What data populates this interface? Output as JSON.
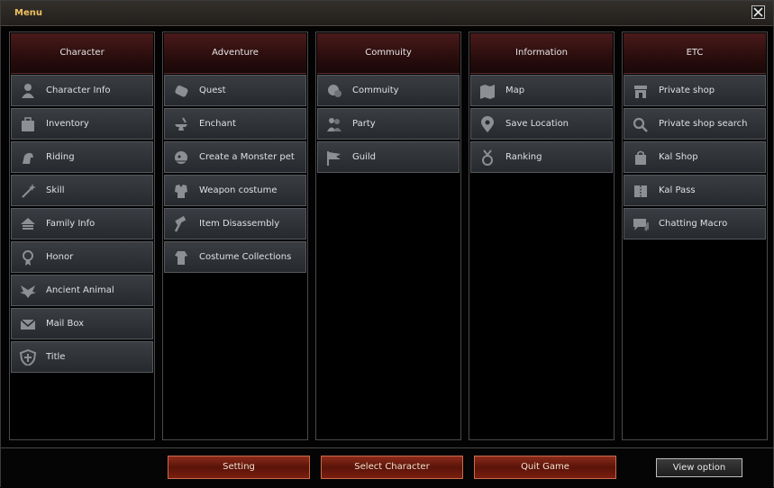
{
  "window": {
    "title": "Menu"
  },
  "columns": [
    {
      "header": "Character",
      "items": [
        {
          "label": "Character Info",
          "icon": "person-icon"
        },
        {
          "label": "Inventory",
          "icon": "bag-icon"
        },
        {
          "label": "Riding",
          "icon": "mount-icon"
        },
        {
          "label": "Skill",
          "icon": "wand-icon"
        },
        {
          "label": "Family Info",
          "icon": "house-icon"
        },
        {
          "label": "Honor",
          "icon": "medal-icon"
        },
        {
          "label": "Ancient Animal",
          "icon": "wings-icon"
        },
        {
          "label": "Mail Box",
          "icon": "envelope-icon"
        },
        {
          "label": "Title",
          "icon": "shield-icon"
        }
      ]
    },
    {
      "header": "Adventure",
      "items": [
        {
          "label": "Quest",
          "icon": "scroll-icon"
        },
        {
          "label": "Enchant",
          "icon": "anvil-icon"
        },
        {
          "label": "Create a Monster pet",
          "icon": "dragon-icon"
        },
        {
          "label": "Weapon costume",
          "icon": "armor-icon"
        },
        {
          "label": "Item Disassembly",
          "icon": "hammer-icon"
        },
        {
          "label": "Costume Collections",
          "icon": "costume-icon"
        }
      ]
    },
    {
      "header": "Commuity",
      "items": [
        {
          "label": "Commuity",
          "icon": "chat-bubbles-icon"
        },
        {
          "label": "Party",
          "icon": "group-icon"
        },
        {
          "label": "Guild",
          "icon": "flag-icon"
        }
      ]
    },
    {
      "header": "Information",
      "items": [
        {
          "label": "Map",
          "icon": "map-icon"
        },
        {
          "label": "Save Location",
          "icon": "location-pin-icon"
        },
        {
          "label": "Ranking",
          "icon": "ranking-medal-icon"
        }
      ]
    },
    {
      "header": "ETC",
      "items": [
        {
          "label": "Private shop",
          "icon": "shop-icon"
        },
        {
          "label": "Private shop search",
          "icon": "search-icon"
        },
        {
          "label": "Kal Shop",
          "icon": "shopping-bag-icon"
        },
        {
          "label": "Kal Pass",
          "icon": "ticket-icon"
        },
        {
          "label": "Chatting Macro",
          "icon": "chat-icon"
        }
      ]
    }
  ],
  "footer": {
    "setting": "Setting",
    "select_character": "Select Character",
    "quit_game": "Quit Game",
    "view_option": "View option"
  }
}
